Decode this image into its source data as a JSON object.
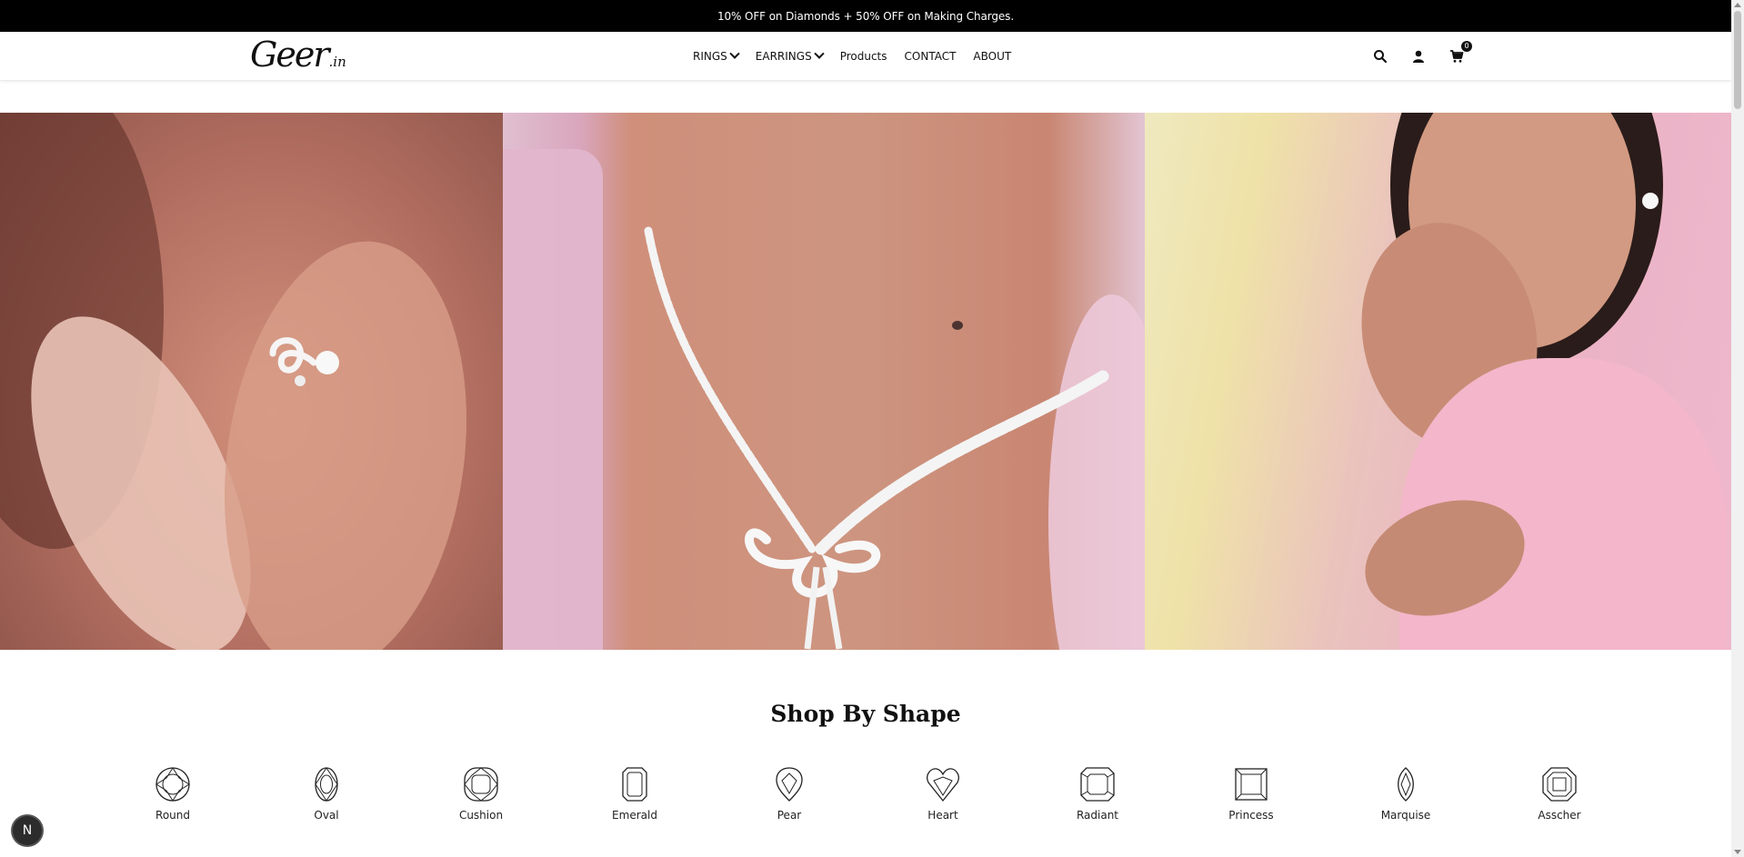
{
  "announcement": "10% OFF on Diamonds + 50% OFF on Making Charges.",
  "logo": {
    "main": "Geer",
    "suffix": ".in"
  },
  "nav": {
    "items": [
      {
        "label": "RINGS",
        "has_dropdown": true
      },
      {
        "label": "EARRINGS",
        "has_dropdown": true
      },
      {
        "label": "Products",
        "has_dropdown": false
      },
      {
        "label": "CONTACT",
        "has_dropdown": false
      },
      {
        "label": "ABOUT",
        "has_dropdown": false
      }
    ]
  },
  "header_icons": {
    "search": "search-icon",
    "account": "user-icon",
    "cart": "cart-icon",
    "cart_count": "0"
  },
  "hero": {
    "panels": [
      "earring-closeup",
      "necklace-closeup",
      "woman-in-pink-jewellery"
    ]
  },
  "shop_by_shape": {
    "title": "Shop By Shape",
    "shapes": [
      {
        "label": "Round",
        "icon": "round-diamond-icon"
      },
      {
        "label": "Oval",
        "icon": "oval-diamond-icon"
      },
      {
        "label": "Cushion",
        "icon": "cushion-diamond-icon"
      },
      {
        "label": "Emerald",
        "icon": "emerald-diamond-icon"
      },
      {
        "label": "Pear",
        "icon": "pear-diamond-icon"
      },
      {
        "label": "Heart",
        "icon": "heart-diamond-icon"
      },
      {
        "label": "Radiant",
        "icon": "radiant-diamond-icon"
      },
      {
        "label": "Princess",
        "icon": "princess-diamond-icon"
      },
      {
        "label": "Marquise",
        "icon": "marquise-diamond-icon"
      },
      {
        "label": "Asscher",
        "icon": "asscher-diamond-icon"
      }
    ]
  },
  "chat_bubble": "N",
  "colors": {
    "announce_bg": "#000000",
    "text": "#111111",
    "page_bg": "#ffffff"
  }
}
